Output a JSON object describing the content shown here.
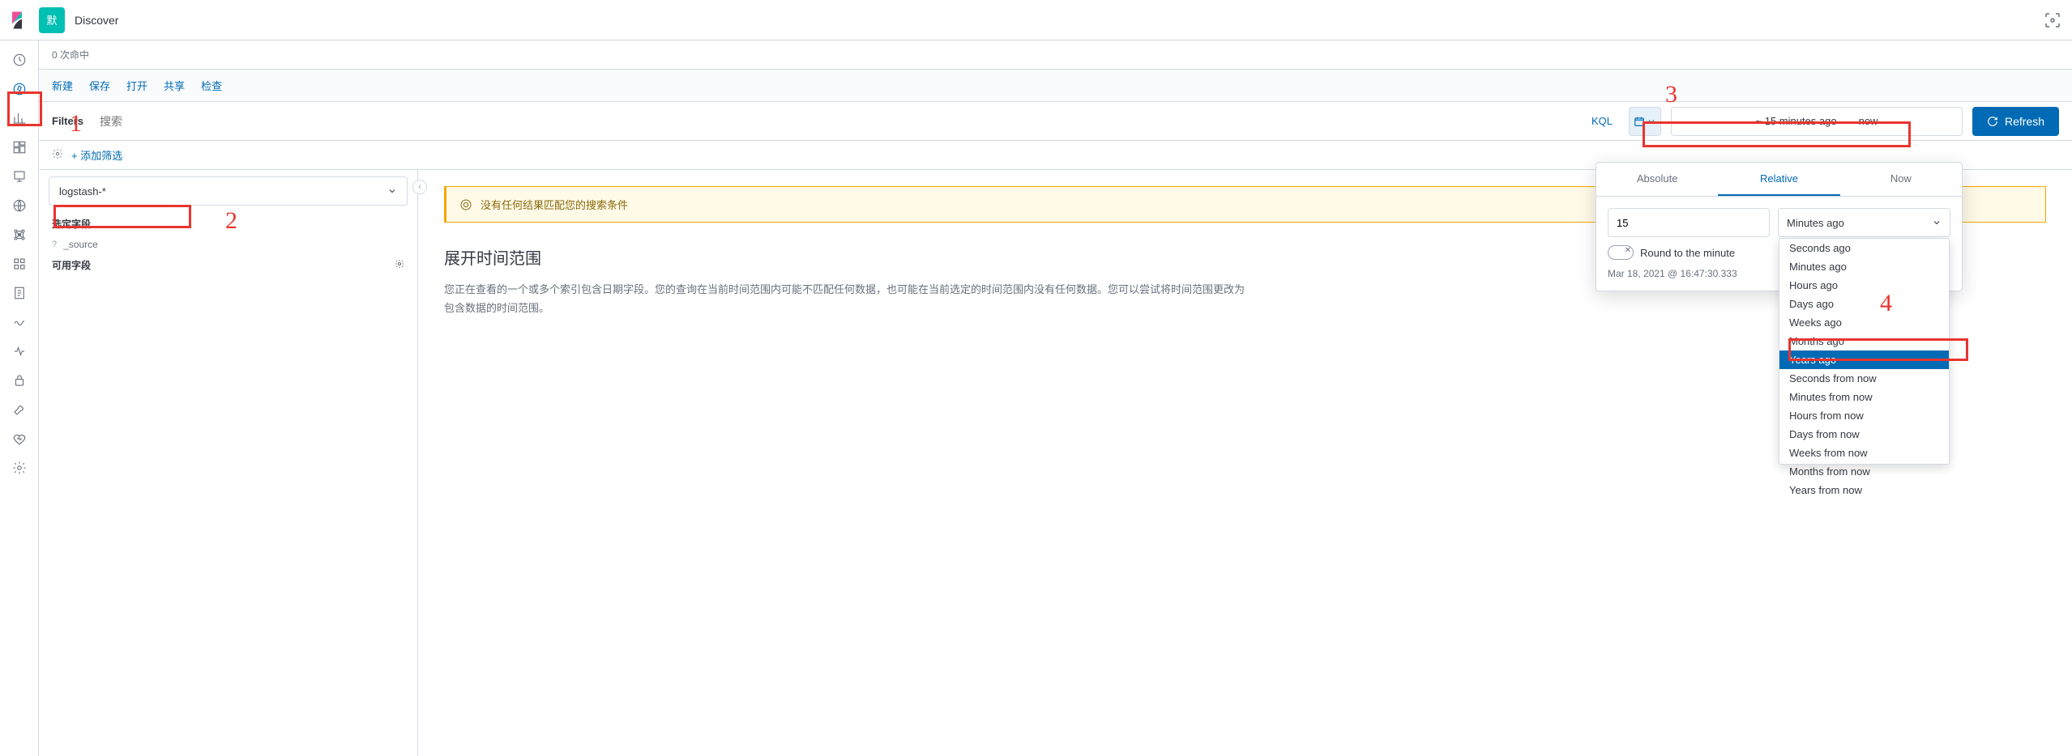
{
  "header": {
    "app_badge": "默",
    "title": "Discover"
  },
  "hitcount": "0 次命中",
  "toolbar": {
    "new": "新建",
    "save": "保存",
    "open": "打开",
    "share": "共享",
    "inspect": "检查"
  },
  "query": {
    "filters_label": "Filters",
    "search_placeholder": "搜索",
    "kql": "KQL",
    "time_from": "~ 15 minutes ago",
    "time_to": "now",
    "refresh": "Refresh"
  },
  "filter_row": {
    "add_filter": "+ 添加筛选"
  },
  "sidebar": {
    "index_pattern": "logstash-*",
    "selected_fields_header": "选定字段",
    "source_field": "_source",
    "available_fields_header": "可用字段"
  },
  "content": {
    "warning": "没有任何结果匹配您的搜索条件",
    "heading": "展开时间范围",
    "text": "您正在查看的一个或多个索引包含日期字段。您的查询在当前时间范围内可能不匹配任何数据，也可能在当前选定的时间范围内没有任何数据。您可以尝试将时间范围更改为包含数据的时间范围。"
  },
  "popover": {
    "tabs": {
      "absolute": "Absolute",
      "relative": "Relative",
      "now": "Now"
    },
    "value": "15",
    "unit_selected": "Minutes ago",
    "round_label": "Round to the minute",
    "start_date": "Mar 18, 2021 @ 16:47:30.333",
    "options": [
      "Seconds ago",
      "Minutes ago",
      "Hours ago",
      "Days ago",
      "Weeks ago",
      "Months ago",
      "Years ago",
      "Seconds from now",
      "Minutes from now",
      "Hours from now",
      "Days from now",
      "Weeks from now",
      "Months from now",
      "Years from now"
    ],
    "highlighted_index": 6
  },
  "annotations": {
    "n1": "1",
    "n2": "2",
    "n3": "3",
    "n4": "4"
  }
}
